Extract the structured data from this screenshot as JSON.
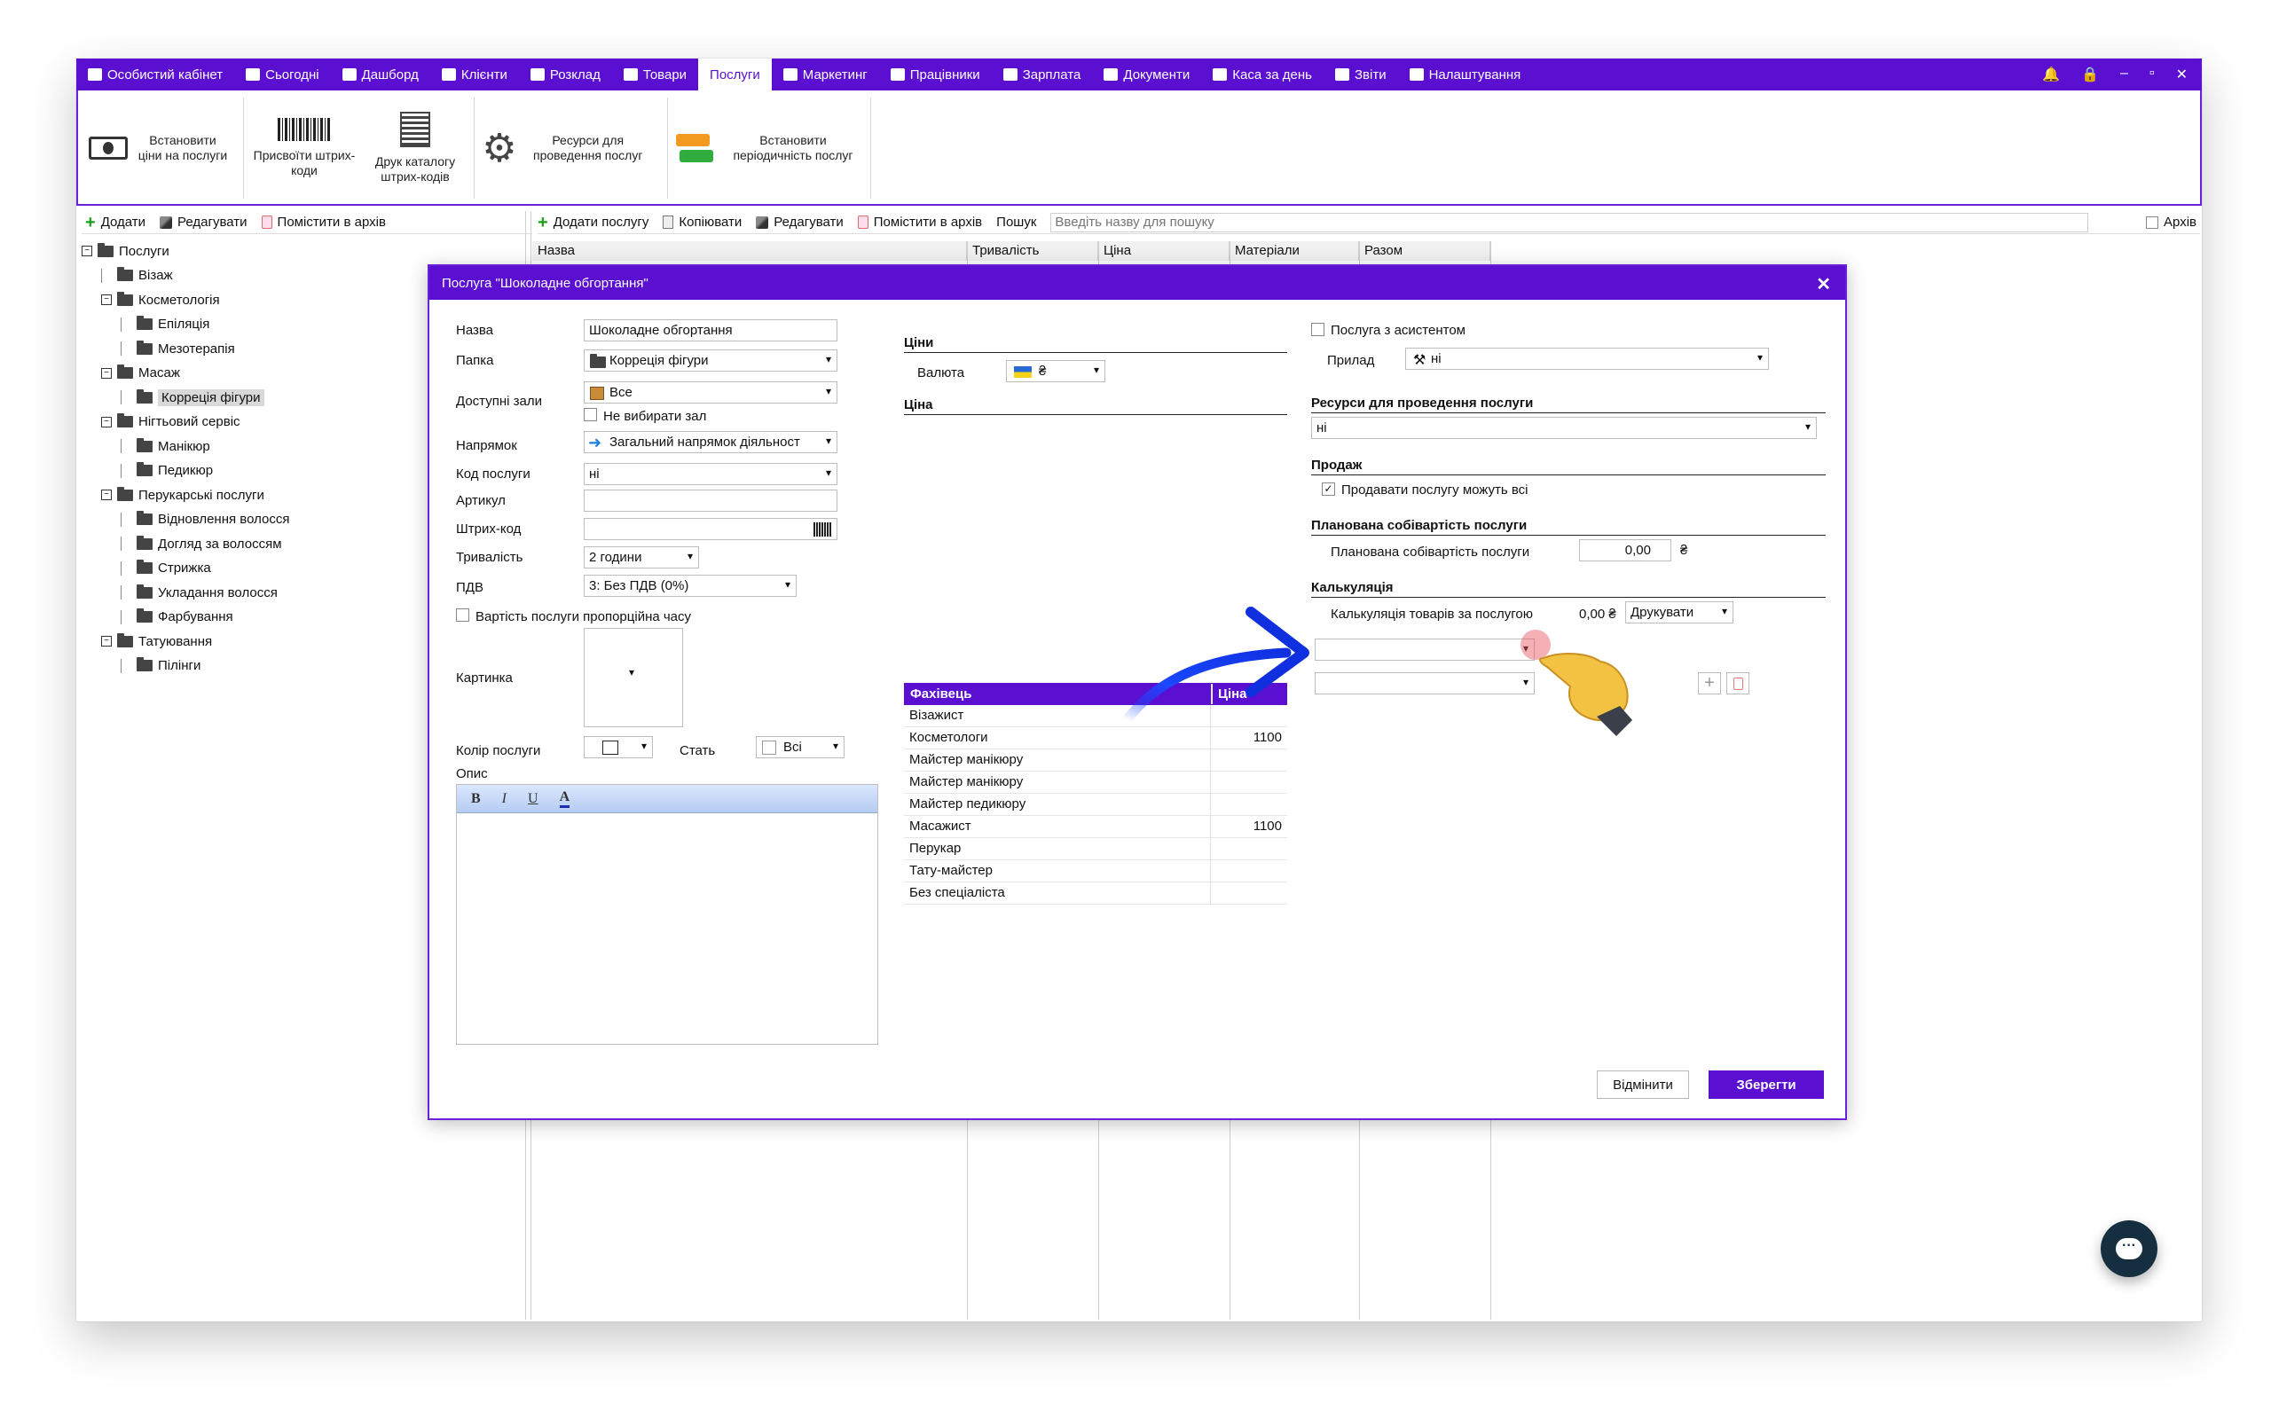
{
  "nav": {
    "items": [
      "Особистий кабінет",
      "Сьогодні",
      "Дашборд",
      "Клієнти",
      "Розклад",
      "Товари",
      "Послуги",
      "Маркетинг",
      "Працівники",
      "Зарплата",
      "Документи",
      "Каса за день",
      "Звіти",
      "Налаштування"
    ],
    "active": "Послуги",
    "accent": "#5b0fd0"
  },
  "ribbon": {
    "set_prices": "Встановити ціни на послуги",
    "assign_barcodes": "Присвоїти штрих-коди",
    "print_catalog": "Друк каталогу штрих-кодів",
    "resources": "Ресурси для проведення послуг",
    "periodicity": "Встановити періодичність послуг"
  },
  "left_toolbar": {
    "add": "Додати",
    "edit": "Редагувати",
    "archive": "Помістити в архів"
  },
  "right_toolbar": {
    "add_service": "Додати послугу",
    "copy": "Копіювати",
    "edit": "Редагувати",
    "archive": "Помістити в архів",
    "search_label": "Пошук",
    "search_placeholder": "Введіть назву для пошуку",
    "archive_check": "Архів"
  },
  "tree": [
    {
      "label": "Послуги",
      "level": 0,
      "exp": true
    },
    {
      "label": "Візаж",
      "level": 1
    },
    {
      "label": "Косметологія",
      "level": 1,
      "exp": true
    },
    {
      "label": "Епіляція",
      "level": 2
    },
    {
      "label": "Мезотерапія",
      "level": 2
    },
    {
      "label": "Масаж",
      "level": 1,
      "exp": true
    },
    {
      "label": "Корреція фігури",
      "level": 2,
      "selected": true
    },
    {
      "label": "Нігтьовий сервіс",
      "level": 1,
      "exp": true
    },
    {
      "label": "Манікюр",
      "level": 2
    },
    {
      "label": "Педикюр",
      "level": 2
    },
    {
      "label": "Перукарські послуги",
      "level": 1,
      "exp": true
    },
    {
      "label": "Відновлення волосся",
      "level": 2
    },
    {
      "label": "Догляд за волоссям",
      "level": 2
    },
    {
      "label": "Стрижка",
      "level": 2
    },
    {
      "label": "Укладання волосся",
      "level": 2
    },
    {
      "label": "Фарбування",
      "level": 2
    },
    {
      "label": "Татуювання",
      "level": 1,
      "exp": true
    },
    {
      "label": "Пілінги",
      "level": 2
    }
  ],
  "grid_columns": [
    "Назва",
    "Тривалість",
    "Ціна",
    "Матеріали",
    "Разом"
  ],
  "dialog": {
    "title": "Послуга \"Шоколадне обгортання\"",
    "name_label": "Назва",
    "name_value": "Шоколадне обгортання",
    "folder_label": "Папка",
    "folder_value": "Корреція фігури",
    "halls_label": "Доступні зали",
    "halls_value": "Все",
    "no_hall": "Не вибирати зал",
    "direction_label": "Напрямок",
    "direction_value": "Загальний напрямок діяльност",
    "code_label": "Код послуги",
    "code_value": "ні",
    "article_label": "Артикул",
    "barcode_label": "Штрих-код",
    "duration_label": "Тривалість",
    "duration_value": "2 години",
    "vat_label": "ПДВ",
    "vat_value": "3: Без ПДВ (0%)",
    "proportional": "Вартість послуги пропорційна часу",
    "picture_label": "Картинка",
    "color_label": "Колір послуги",
    "gender_label": "Стать",
    "gender_value": "Всі",
    "desc_label": "Опис",
    "prices_section": "Ціни",
    "currency_label": "Валюта",
    "currency_value": "₴",
    "price_section": "Ціна",
    "price_head": [
      "Фахівець",
      "Ціна"
    ],
    "price_rows": [
      [
        "Візажист",
        ""
      ],
      [
        "Косметологи",
        "1100"
      ],
      [
        "Майстер манікюру",
        ""
      ],
      [
        "Майстер манікюру",
        ""
      ],
      [
        "Майстер педикюру",
        ""
      ],
      [
        "Масажист",
        "1100"
      ],
      [
        "Перукар",
        ""
      ],
      [
        "Тату-майстер",
        ""
      ],
      [
        "Без спеціаліста",
        ""
      ]
    ],
    "assistant": "Послуга з асистентом",
    "device_label": "Прилад",
    "device_value": "ні",
    "resources_section": "Ресурси для проведення послуги",
    "resources_value": "ні",
    "sale_section": "Продаж",
    "sale_all": "Продавати послугу можуть всі",
    "cost_section": "Планована собівартість послуги",
    "cost_label": "Планована собівартість послуги",
    "cost_value": "0,00",
    "cost_currency": "₴",
    "calc_section": "Калькуляція",
    "calc_label": "Калькуляція товарів за послугою",
    "calc_value": "0,00 ₴",
    "print_label": "Друкувати",
    "cancel": "Відмінити",
    "save": "Зберегти"
  }
}
